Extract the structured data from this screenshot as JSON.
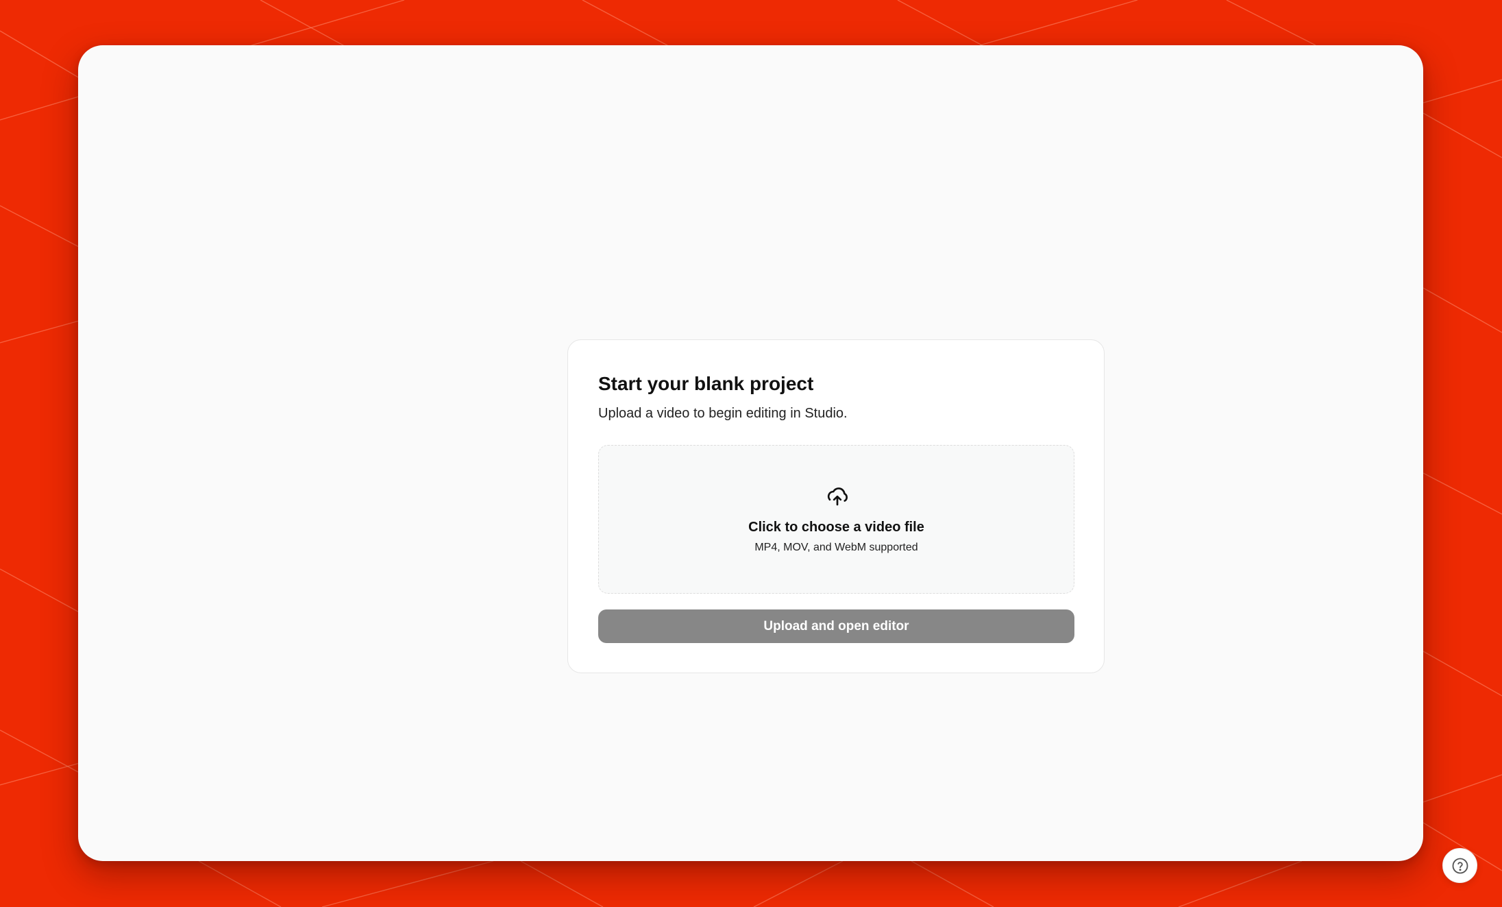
{
  "colors": {
    "background": "#ee2a03",
    "window": "#fafafa",
    "card": "#ffffff",
    "button_disabled": "#878787"
  },
  "card": {
    "title": "Start your blank project",
    "subtitle": "Upload a video to begin editing in Studio."
  },
  "dropzone": {
    "icon": "cloud-upload-icon",
    "title": "Click to choose a video file",
    "hint": "MP4, MOV, and WebM supported"
  },
  "actions": {
    "upload_label": "Upload and open editor"
  },
  "help": {
    "icon": "help-circle-icon"
  }
}
